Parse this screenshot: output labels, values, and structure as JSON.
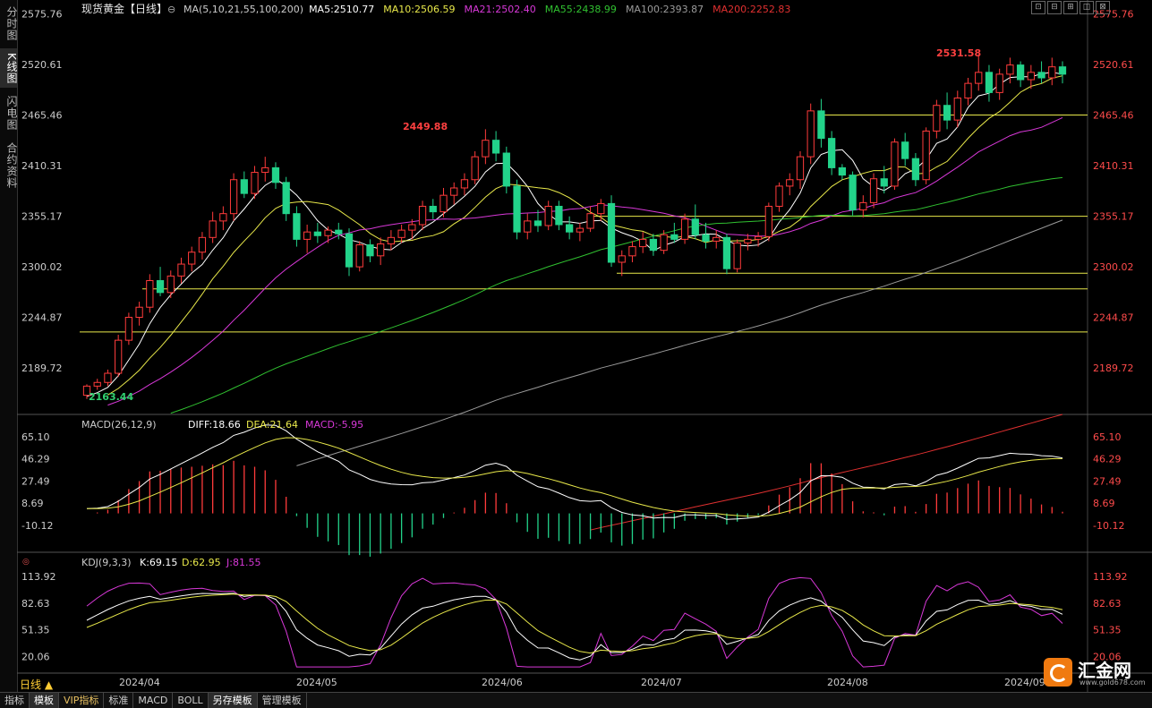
{
  "sidebar": {
    "tabs": [
      "分时图",
      "K线图",
      "闪电图",
      "合约资料"
    ],
    "active": 1
  },
  "header": {
    "title": "现货黄金【日线】",
    "ma_params": "MA(5,10,21,55,100,200)",
    "ma_values": [
      "MA5:2510.77",
      "MA10:2506.59",
      "MA21:2502.40",
      "MA55:2438.99",
      "MA100:2393.87",
      "MA200:2252.83"
    ]
  },
  "window_controls": [
    "⊡",
    "⊟",
    "⊞",
    "◫",
    "⊠"
  ],
  "price_axis": [
    "2575.76",
    "2520.61",
    "2465.46",
    "2410.31",
    "2355.17",
    "2300.02",
    "2244.87",
    "2189.72"
  ],
  "annotations": {
    "high": "2531.58",
    "mid_high": "2449.88",
    "low": "2163.44"
  },
  "macd": {
    "title": "MACD(26,12,9)",
    "diff": "DIFF:18.66",
    "dea": "DEA:21.64",
    "macd": "MACD:-5.95",
    "ticks": [
      "65.10",
      "46.29",
      "27.49",
      "8.69",
      "-10.12"
    ]
  },
  "kdj": {
    "title": "KDJ(9,3,3)",
    "k": "K:69.15",
    "d": "D:62.95",
    "j": "J:81.55",
    "ticks": [
      "113.92",
      "82.63",
      "51.35",
      "20.06"
    ]
  },
  "dates": [
    "2024/04",
    "2024/05",
    "2024/06",
    "2024/07",
    "2024/08",
    "2024/09"
  ],
  "period_button": "日线 ▲",
  "bottom_tabs": [
    "指标",
    "模板",
    "VIP指标",
    "标准",
    "MACD",
    "BOLL",
    "另存模板",
    "管理模板"
  ],
  "logo": {
    "name": "汇金网",
    "url": "www.gold678.com"
  },
  "colors": {
    "up": "#ff3b3b",
    "down": "#22d38a",
    "ma5": "#ffffff",
    "ma10": "#e8e84a",
    "ma21": "#d838d8",
    "ma55": "#30c030",
    "ma100": "#9a9a9a",
    "ma200": "#e03030",
    "level": "#e8e84a"
  },
  "chart_data": {
    "type": "candlestick",
    "title": "现货黄金【日线】",
    "ylim": [
      2145,
      2585
    ],
    "support_levels": [
      2465.46,
      2355.17,
      2293,
      2276,
      2229
    ],
    "series_note": "daily OHLC, early April to early September 2024",
    "candles": [
      [
        2160,
        2172,
        2156,
        2170
      ],
      [
        2170,
        2178,
        2166,
        2174
      ],
      [
        2174,
        2188,
        2170,
        2184
      ],
      [
        2184,
        2226,
        2180,
        2220
      ],
      [
        2220,
        2250,
        2215,
        2245
      ],
      [
        2245,
        2262,
        2236,
        2256
      ],
      [
        2256,
        2292,
        2250,
        2285
      ],
      [
        2285,
        2300,
        2268,
        2272
      ],
      [
        2272,
        2296,
        2266,
        2290
      ],
      [
        2290,
        2310,
        2282,
        2303
      ],
      [
        2303,
        2322,
        2295,
        2316
      ],
      [
        2316,
        2338,
        2308,
        2332
      ],
      [
        2332,
        2360,
        2326,
        2350
      ],
      [
        2350,
        2366,
        2340,
        2358
      ],
      [
        2358,
        2402,
        2350,
        2395
      ],
      [
        2395,
        2404,
        2375,
        2380
      ],
      [
        2380,
        2410,
        2374,
        2403
      ],
      [
        2403,
        2420,
        2393,
        2408
      ],
      [
        2408,
        2414,
        2385,
        2392
      ],
      [
        2392,
        2398,
        2350,
        2358
      ],
      [
        2358,
        2366,
        2322,
        2330
      ],
      [
        2330,
        2346,
        2315,
        2338
      ],
      [
        2338,
        2348,
        2326,
        2334
      ],
      [
        2334,
        2344,
        2326,
        2340
      ],
      [
        2340,
        2348,
        2330,
        2336
      ],
      [
        2336,
        2342,
        2290,
        2300
      ],
      [
        2300,
        2328,
        2295,
        2324
      ],
      [
        2324,
        2330,
        2305,
        2312
      ],
      [
        2312,
        2332,
        2302,
        2325
      ],
      [
        2325,
        2340,
        2318,
        2332
      ],
      [
        2332,
        2346,
        2326,
        2340
      ],
      [
        2340,
        2352,
        2330,
        2346
      ],
      [
        2346,
        2372,
        2340,
        2366
      ],
      [
        2366,
        2374,
        2352,
        2360
      ],
      [
        2360,
        2386,
        2354,
        2378
      ],
      [
        2378,
        2392,
        2368,
        2386
      ],
      [
        2386,
        2402,
        2378,
        2395
      ],
      [
        2395,
        2426,
        2390,
        2420
      ],
      [
        2420,
        2450,
        2412,
        2438
      ],
      [
        2438,
        2448,
        2415,
        2424
      ],
      [
        2424,
        2431,
        2380,
        2388
      ],
      [
        2388,
        2395,
        2330,
        2338
      ],
      [
        2338,
        2358,
        2330,
        2350
      ],
      [
        2350,
        2362,
        2338,
        2345
      ],
      [
        2345,
        2372,
        2340,
        2366
      ],
      [
        2366,
        2372,
        2340,
        2346
      ],
      [
        2346,
        2355,
        2330,
        2338
      ],
      [
        2338,
        2348,
        2328,
        2342
      ],
      [
        2342,
        2366,
        2338,
        2358
      ],
      [
        2358,
        2374,
        2350,
        2369
      ],
      [
        2369,
        2378,
        2300,
        2305
      ],
      [
        2305,
        2318,
        2290,
        2312
      ],
      [
        2312,
        2328,
        2305,
        2322
      ],
      [
        2322,
        2338,
        2315,
        2330
      ],
      [
        2330,
        2336,
        2312,
        2318
      ],
      [
        2318,
        2340,
        2314,
        2335
      ],
      [
        2335,
        2348,
        2326,
        2330
      ],
      [
        2330,
        2358,
        2325,
        2352
      ],
      [
        2352,
        2368,
        2330,
        2335
      ],
      [
        2335,
        2348,
        2320,
        2328
      ],
      [
        2328,
        2340,
        2320,
        2332
      ],
      [
        2332,
        2336,
        2292,
        2298
      ],
      [
        2298,
        2330,
        2294,
        2326
      ],
      [
        2326,
        2336,
        2318,
        2330
      ],
      [
        2330,
        2338,
        2322,
        2333
      ],
      [
        2333,
        2370,
        2328,
        2366
      ],
      [
        2366,
        2392,
        2360,
        2388
      ],
      [
        2388,
        2402,
        2378,
        2395
      ],
      [
        2395,
        2426,
        2385,
        2420
      ],
      [
        2420,
        2478,
        2412,
        2470
      ],
      [
        2470,
        2483,
        2430,
        2440
      ],
      [
        2440,
        2448,
        2400,
        2408
      ],
      [
        2408,
        2412,
        2395,
        2400
      ],
      [
        2400,
        2404,
        2356,
        2362
      ],
      [
        2362,
        2378,
        2354,
        2370
      ],
      [
        2370,
        2402,
        2364,
        2396
      ],
      [
        2396,
        2410,
        2380,
        2388
      ],
      [
        2388,
        2440,
        2384,
        2436
      ],
      [
        2436,
        2446,
        2410,
        2418
      ],
      [
        2418,
        2424,
        2388,
        2395
      ],
      [
        2395,
        2452,
        2390,
        2448
      ],
      [
        2448,
        2482,
        2440,
        2476
      ],
      [
        2476,
        2490,
        2450,
        2460
      ],
      [
        2460,
        2492,
        2452,
        2484
      ],
      [
        2484,
        2506,
        2476,
        2500
      ],
      [
        2500,
        2531.58,
        2492,
        2512
      ],
      [
        2512,
        2520,
        2480,
        2490
      ],
      [
        2490,
        2516,
        2482,
        2510
      ],
      [
        2510,
        2528,
        2500,
        2520
      ],
      [
        2520,
        2524,
        2496,
        2504
      ],
      [
        2504,
        2520,
        2494,
        2512
      ],
      [
        2512,
        2524,
        2500,
        2506
      ],
      [
        2506,
        2528,
        2498,
        2518
      ],
      [
        2518,
        2524,
        2500,
        2510
      ]
    ]
  }
}
